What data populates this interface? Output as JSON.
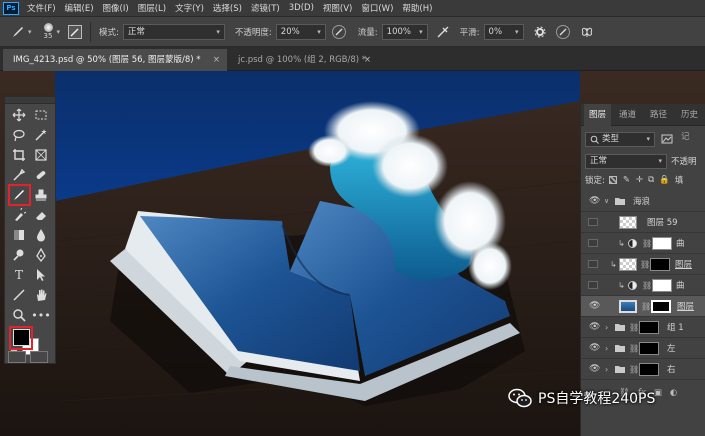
{
  "app": {
    "logo": "Ps"
  },
  "menu": [
    "文件(F)",
    "编辑(E)",
    "图像(I)",
    "图层(L)",
    "文字(Y)",
    "选择(S)",
    "滤镜(T)",
    "3D(D)",
    "视图(V)",
    "窗口(W)",
    "帮助(H)"
  ],
  "options": {
    "brush_size": "35",
    "mode_label": "模式:",
    "mode_value": "正常",
    "opacity_label": "不透明度:",
    "opacity_value": "20%",
    "flow_label": "流量:",
    "flow_value": "100%",
    "smoothing_label": "平滑:",
    "smoothing_value": "0%"
  },
  "tabs": [
    {
      "label": "IMG_4213.psd @ 50% (图层 56, 图层蒙版/8) *",
      "close": "×"
    },
    {
      "label": "jc.psd @ 100% (组 2, RGB/8) *",
      "close": "×"
    }
  ],
  "layers_panel": {
    "tabs": [
      "图层",
      "通道",
      "路径",
      "历史记"
    ],
    "filter_label": "类型",
    "blend_value": "正常",
    "opacity_label": "不透明",
    "lock_label": "锁定:",
    "fill_label": "填",
    "layers": [
      {
        "name": "海浪",
        "type": "group"
      },
      {
        "name": "图层 59",
        "type": "layer"
      },
      {
        "name": "曲",
        "type": "adjust"
      },
      {
        "name": "图层",
        "type": "layer-mask"
      },
      {
        "name": "曲",
        "type": "adjust"
      },
      {
        "name": "图层",
        "type": "layer-mask-selected"
      },
      {
        "name": "组 1",
        "type": "group"
      },
      {
        "name": "左",
        "type": "group"
      },
      {
        "name": "右",
        "type": "group"
      }
    ]
  },
  "watermark": {
    "text": "PS自学教程240PS"
  },
  "colors": {
    "highlight": "#e3232b",
    "accent": "#31a8ff",
    "foreground": "#000000",
    "background": "#ffffff"
  }
}
